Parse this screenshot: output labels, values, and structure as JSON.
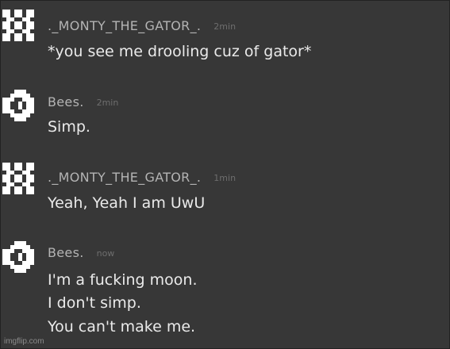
{
  "messages": [
    {
      "author": "._MONTY_THE_GATOR_.",
      "time": "2min",
      "avatar_icon": "monty-pixel-avatar-icon",
      "lines": [
        "*you see me drooling cuz of gator*"
      ]
    },
    {
      "author": "Bees.",
      "time": "2min",
      "avatar_icon": "bees-pixel-avatar-icon",
      "lines": [
        "Simp."
      ]
    },
    {
      "author": "._MONTY_THE_GATOR_.",
      "time": "1min",
      "avatar_icon": "monty-pixel-avatar-icon",
      "lines": [
        "Yeah, Yeah I am UwU"
      ]
    },
    {
      "author": "Bees.",
      "time": "now",
      "avatar_icon": "bees-pixel-avatar-icon",
      "lines": [
        "I'm a fucking moon.",
        "I don't simp.",
        "You can't make me."
      ]
    }
  ],
  "watermark": "imgflip.com",
  "colors": {
    "background": "#373737",
    "username": "#b4b4b4",
    "timestamp": "#6e6e6e",
    "message_text": "#eaeaea",
    "avatar": "#ffffff"
  }
}
